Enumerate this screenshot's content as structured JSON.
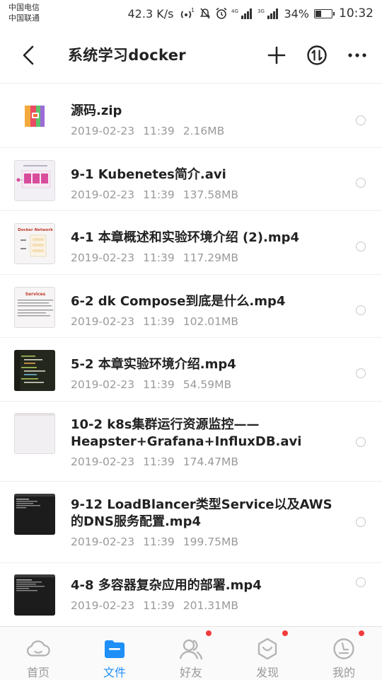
{
  "status_bar": {
    "carrier_1": "中国电信",
    "carrier_2": "中国联通",
    "speed": "42.3 K/s",
    "hotspot_badge": "1",
    "net_1": "4G",
    "net_2": "3G",
    "battery": "34%",
    "battery_level": 0.34,
    "time": "10:32"
  },
  "header": {
    "title": "系统学习docker",
    "back_icon": "back-arrow-icon",
    "add_icon": "plus-icon",
    "sort_icon": "sort-icon",
    "more_icon": "more-icon"
  },
  "files": [
    {
      "name": "源码.zip",
      "date": "2019-02-23",
      "time": "11:39",
      "size": "2.16MB",
      "thumb": "zip"
    },
    {
      "name": "9-1 Kubenetes简介.avi",
      "date": "2019-02-23",
      "time": "11:39",
      "size": "137.58MB",
      "thumb": "slide-kube"
    },
    {
      "name": "4-1 本章概述和实验环境介绍 (2).mp4",
      "date": "2019-02-23",
      "time": "11:39",
      "size": "117.29MB",
      "thumb": "slide-network",
      "thumb_title": "Docker Network"
    },
    {
      "name": "6-2 dk Compose到底是什么.mp4",
      "date": "2019-02-23",
      "time": "11:39",
      "size": "102.01MB",
      "thumb": "slide-services",
      "thumb_title": "Services"
    },
    {
      "name": "5-2 本章实验环境介绍.mp4",
      "date": "2019-02-23",
      "time": "11:39",
      "size": "54.59MB",
      "thumb": "code"
    },
    {
      "name": "10-2 k8s集群运行资源监控——Heapster+Grafana+InfluxDB.avi",
      "date": "2019-02-23",
      "time": "11:39",
      "size": "174.47MB",
      "thumb": "blank"
    },
    {
      "name": "9-12 LoadBlancer类型Service以及AWS的DNS服务配置.mp4",
      "date": "2019-02-23",
      "time": "11:39",
      "size": "199.75MB",
      "thumb": "terminal"
    },
    {
      "name": "4-8 多容器复杂应用的部署.mp4",
      "date": "2019-02-23",
      "time": "11:39",
      "size": "201.31MB",
      "thumb": "terminal"
    }
  ],
  "tabs": [
    {
      "label": "首页",
      "icon": "cloud-icon",
      "active": false,
      "badge": false
    },
    {
      "label": "文件",
      "icon": "folder-icon",
      "active": true,
      "badge": false
    },
    {
      "label": "好友",
      "icon": "friends-icon",
      "active": false,
      "badge": true
    },
    {
      "label": "发现",
      "icon": "discover-icon",
      "active": false,
      "badge": true
    },
    {
      "label": "我的",
      "icon": "profile-icon",
      "active": false,
      "badge": true
    }
  ],
  "colors": {
    "accent": "#1e8ff7",
    "badge": "#f23c3c",
    "meta_text": "#9a9a9a"
  }
}
